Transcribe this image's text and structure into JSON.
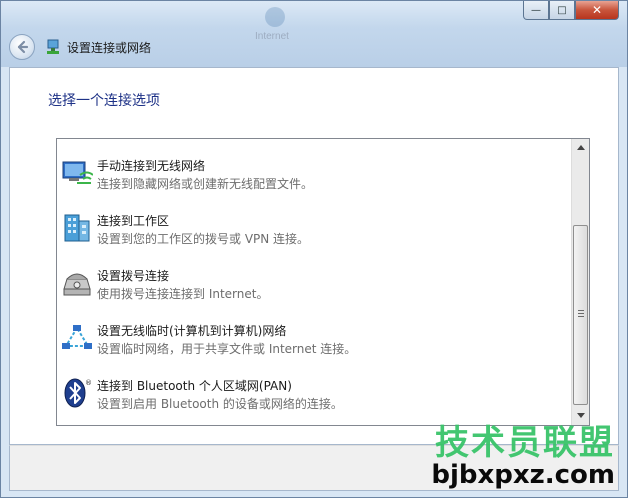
{
  "window": {
    "nav_title": "设置连接或网络",
    "background_app_text": "Internet"
  },
  "controls": {
    "minimize": "—",
    "maximize": "□",
    "close": "✕"
  },
  "main": {
    "heading": "选择一个连接选项"
  },
  "options": [
    {
      "title": "手动连接到无线网络",
      "description": "连接到隐藏网络或创建新无线配置文件。",
      "icon": "wireless-network-icon"
    },
    {
      "title": "连接到工作区",
      "description": "设置到您的工作区的拨号或 VPN 连接。",
      "icon": "workplace-building-icon"
    },
    {
      "title": "设置拨号连接",
      "description": "使用拨号连接连接到 Internet。",
      "icon": "dialup-phone-icon"
    },
    {
      "title": "设置无线临时(计算机到计算机)网络",
      "description": "设置临时网络，用于共享文件或 Internet 连接。",
      "icon": "adhoc-network-icon"
    },
    {
      "title": "连接到 Bluetooth 个人区域网(PAN)",
      "description": "设置到启用 Bluetooth 的设备或网络的连接。",
      "icon": "bluetooth-icon"
    }
  ],
  "watermark": {
    "cn": "技术员联盟",
    "en": "bjbxpxz.com"
  },
  "colors": {
    "heading": "#1e3287",
    "description": "#6d6d6d",
    "watermark_green": "#39c46a"
  }
}
